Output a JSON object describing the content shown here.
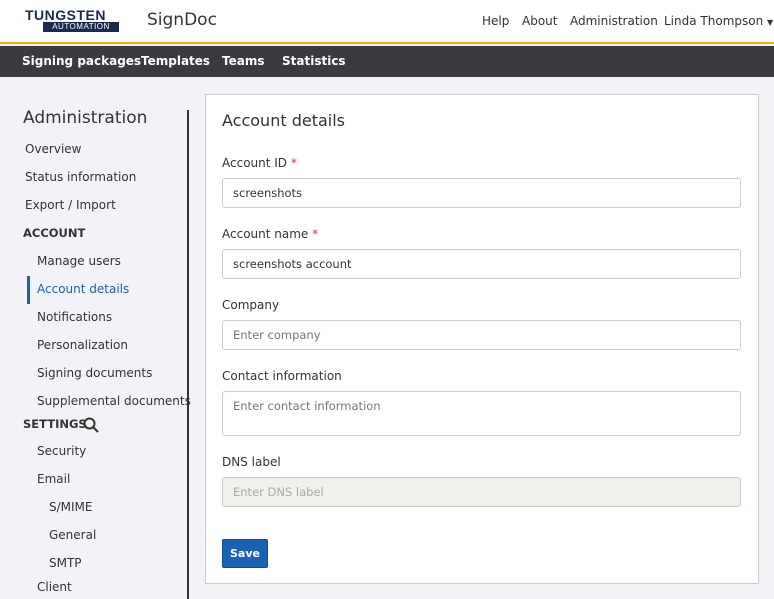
{
  "header": {
    "logo_top": "TUNGSTEN",
    "logo_bottom": "AUTOMATION",
    "app_name": "SignDoc",
    "links": [
      "Help",
      "About",
      "Administration"
    ],
    "user": "Linda Thompson"
  },
  "nav": [
    "Signing packages",
    "Templates",
    "Teams",
    "Statistics"
  ],
  "sidebar": {
    "title": "Administration",
    "items": [
      "Overview",
      "Status information",
      "Export / Import"
    ],
    "account_header": "ACCOUNT",
    "account_items": [
      "Manage users",
      "Account details",
      "Notifications",
      "Personalization",
      "Signing documents",
      "Supplemental documents"
    ],
    "settings_header": "SETTINGS",
    "settings_items": [
      "Security",
      "Email"
    ],
    "email_items": [
      "S/MIME",
      "General",
      "SMTP"
    ],
    "client": "Client"
  },
  "form": {
    "title": "Account details",
    "account_id_label": "Account ID",
    "account_id": "screenshots",
    "account_name_label": "Account name",
    "account_name": "screenshots account",
    "company_label": "Company",
    "company_placeholder": "Enter company",
    "contact_label": "Contact information",
    "contact_placeholder": "Enter contact information",
    "dns_label": "DNS label",
    "dns_placeholder": "Enter DNS label",
    "required_mark": "*",
    "save": "Save"
  }
}
